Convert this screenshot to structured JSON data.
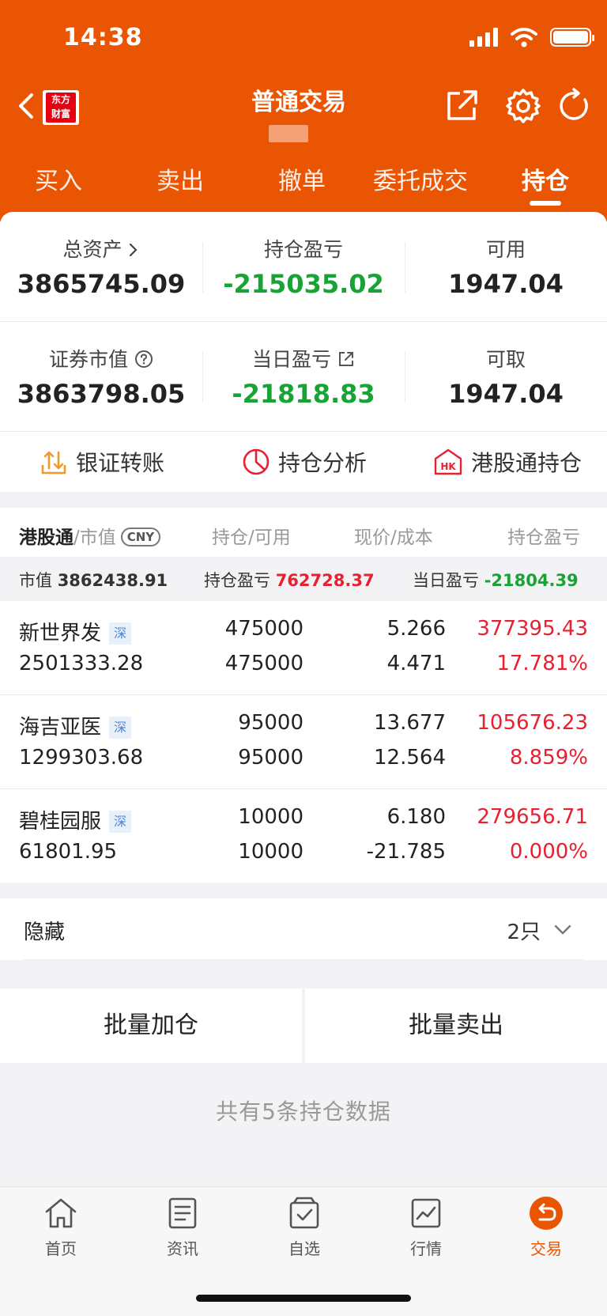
{
  "status_bar": {
    "time": "14:38"
  },
  "nav": {
    "logo_line1": "东方",
    "logo_line2": "财富",
    "title": "普通交易"
  },
  "tabs": [
    {
      "label": "买入"
    },
    {
      "label": "卖出"
    },
    {
      "label": "撤单"
    },
    {
      "label": "委托成交"
    },
    {
      "label": "持仓",
      "active": true
    }
  ],
  "summary": {
    "total_assets_label": "总资产",
    "total_assets_value": "3865745.09",
    "position_pl_label": "持仓盈亏",
    "position_pl_value": "-215035.02",
    "available_label": "可用",
    "available_value": "1947.04",
    "market_value_label": "证券市值",
    "market_value_value": "3863798.05",
    "daily_pl_label": "当日盈亏",
    "daily_pl_value": "-21818.83",
    "withdrawable_label": "可取",
    "withdrawable_value": "1947.04"
  },
  "shortcuts": {
    "bank_transfer": "银证转账",
    "position_analysis": "持仓分析",
    "hk_position": "港股通持仓",
    "hk_badge": "HK"
  },
  "holdings_header": {
    "col1_strong": "港股通",
    "col1_rest": "/市值",
    "currency": "CNY",
    "col2": "持仓/可用",
    "col3": "现价/成本",
    "col4": "持仓盈亏"
  },
  "market_summary": {
    "mv_label": "市值",
    "mv_value": "3862438.91",
    "pl_label": "持仓盈亏",
    "pl_value": "762728.37",
    "daily_label": "当日盈亏",
    "daily_value": "-21804.39"
  },
  "stocks": [
    {
      "name": "新世界发",
      "market": "深",
      "market_value": "2501333.28",
      "position": "475000",
      "available": "475000",
      "price": "5.266",
      "cost": "4.471",
      "pl": "377395.43",
      "pl_pct": "17.781%"
    },
    {
      "name": "海吉亚医",
      "market": "深",
      "market_value": "1299303.68",
      "position": "95000",
      "available": "95000",
      "price": "13.677",
      "cost": "12.564",
      "pl": "105676.23",
      "pl_pct": "8.859%"
    },
    {
      "name": "碧桂园服",
      "market": "深",
      "market_value": "61801.95",
      "position": "10000",
      "available": "10000",
      "price": "6.180",
      "cost": "-21.785",
      "pl": "279656.71",
      "pl_pct": "0.000%"
    }
  ],
  "hidden": {
    "label": "隐藏",
    "count": "2只"
  },
  "batch": {
    "add": "批量加仓",
    "sell": "批量卖出"
  },
  "total_text": "共有5条持仓数据",
  "bottom_nav": [
    {
      "label": "首页",
      "icon": "home-icon"
    },
    {
      "label": "资讯",
      "icon": "news-icon"
    },
    {
      "label": "自选",
      "icon": "watchlist-icon"
    },
    {
      "label": "行情",
      "icon": "market-chart-icon"
    },
    {
      "label": "交易",
      "icon": "trade-icon",
      "active": true
    }
  ],
  "colors": {
    "brand": "#ea5504",
    "up": "#e8202f",
    "down": "#17a434"
  }
}
